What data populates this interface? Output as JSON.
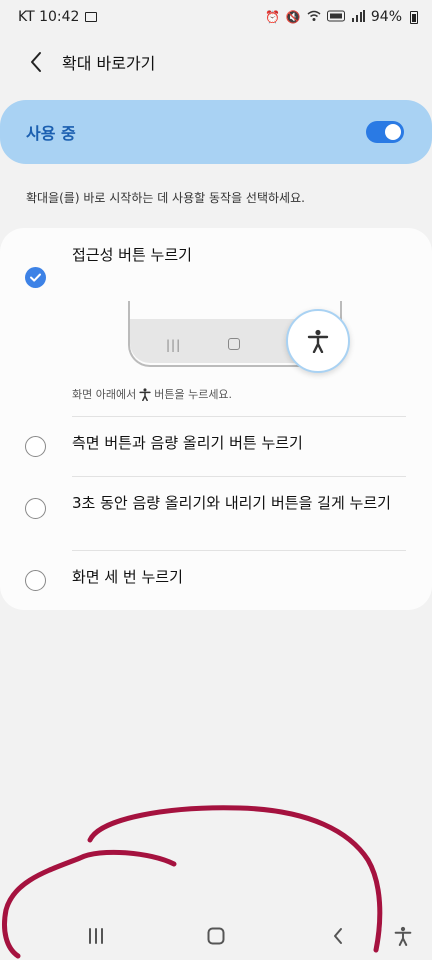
{
  "status_bar": {
    "carrier_time": "KT 10:42",
    "battery_percent": "94%"
  },
  "header": {
    "title": "확대 바로가기"
  },
  "master_switch": {
    "label": "사용 중",
    "on": true
  },
  "description": "확대을(를) 바로 시작하는 데 사용할 동작을 선택하세요.",
  "options": [
    {
      "label": "접근성 버튼 누르기",
      "checked": true
    },
    {
      "label": "측면 버튼과 음량 올리기 버튼 누르기",
      "checked": false
    },
    {
      "label": "3초 동안 음량 올리기와 내리기 버튼을 길게 누르기",
      "checked": false
    },
    {
      "label": "화면 세 번 누르기",
      "checked": false
    }
  ],
  "hint": {
    "prefix": "화면 아래에서",
    "suffix": "버튼을 누르세요."
  },
  "colors": {
    "accent": "#3d82e6",
    "master_bg": "#a9d2f3",
    "scribble": "#a5123f"
  },
  "icons": {
    "back": "chevron-left-icon",
    "accessibility": "accessibility-icon",
    "recent_apps": "recent-apps-icon",
    "home": "home-icon",
    "nav_back": "chevron-left-icon"
  }
}
